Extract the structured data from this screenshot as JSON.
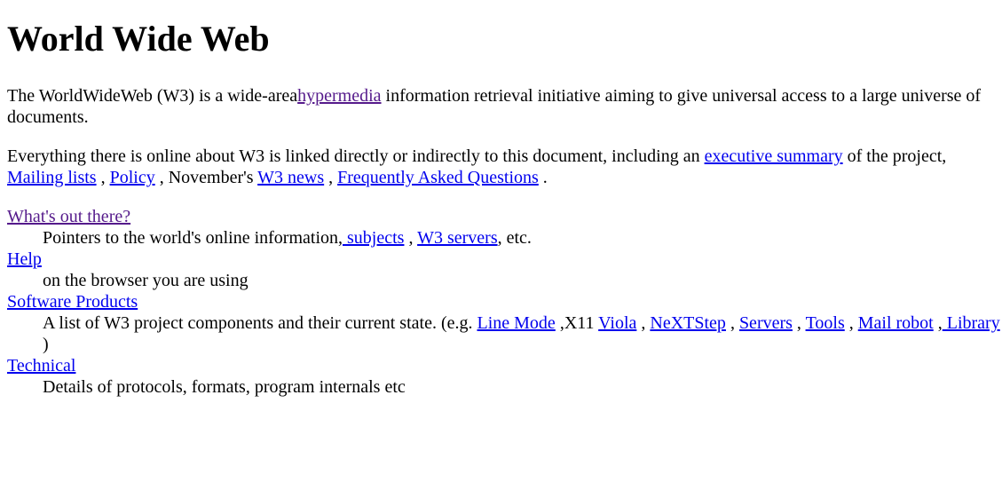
{
  "title": "World Wide Web",
  "intro": {
    "t1": "The WorldWideWeb (W3) is a wide-area",
    "link_hypermedia": "hypermedia",
    "t2": " information retrieval initiative aiming to give universal access to a large universe of documents."
  },
  "summary": {
    "t1": "Everything there is online about W3 is linked directly or indirectly to this document, including an ",
    "link_exec": "executive summary",
    "t2": " of the project, ",
    "link_mailing": "Mailing lists",
    "t3": " , ",
    "link_policy": "Policy",
    "t4": " , November's ",
    "link_news": "W3 news",
    "t5": " , ",
    "link_faq": "Frequently Asked Questions",
    "t6": " ."
  },
  "entries": {
    "whats_out": {
      "term": "What's out there?",
      "d1": "Pointers to the world's online information,",
      "link_subjects": " subjects",
      "d2": " , ",
      "link_servers": "W3 servers",
      "d3": ", etc."
    },
    "help": {
      "term": "Help",
      "desc": "on the browser you are using"
    },
    "software": {
      "term": "Software Products",
      "d1": "A list of W3 project components and their current state. (e.g. ",
      "link_linemode": "Line Mode",
      "d2": " ,X11 ",
      "link_viola": "Viola",
      "d3": " , ",
      "link_next": "NeXTStep",
      "d4": " , ",
      "link_servers": "Servers",
      "d5": " , ",
      "link_tools": "Tools",
      "d6": " , ",
      "link_mailrobot": "Mail robot",
      "d7": " ,",
      "link_library": " Library",
      "d8": " )"
    },
    "technical": {
      "term": "Technical",
      "desc": "Details of protocols, formats, program internals etc"
    }
  },
  "colors": {
    "link": "#0000ee",
    "visited": "#551a8b",
    "text": "#000000",
    "background": "#ffffff"
  }
}
